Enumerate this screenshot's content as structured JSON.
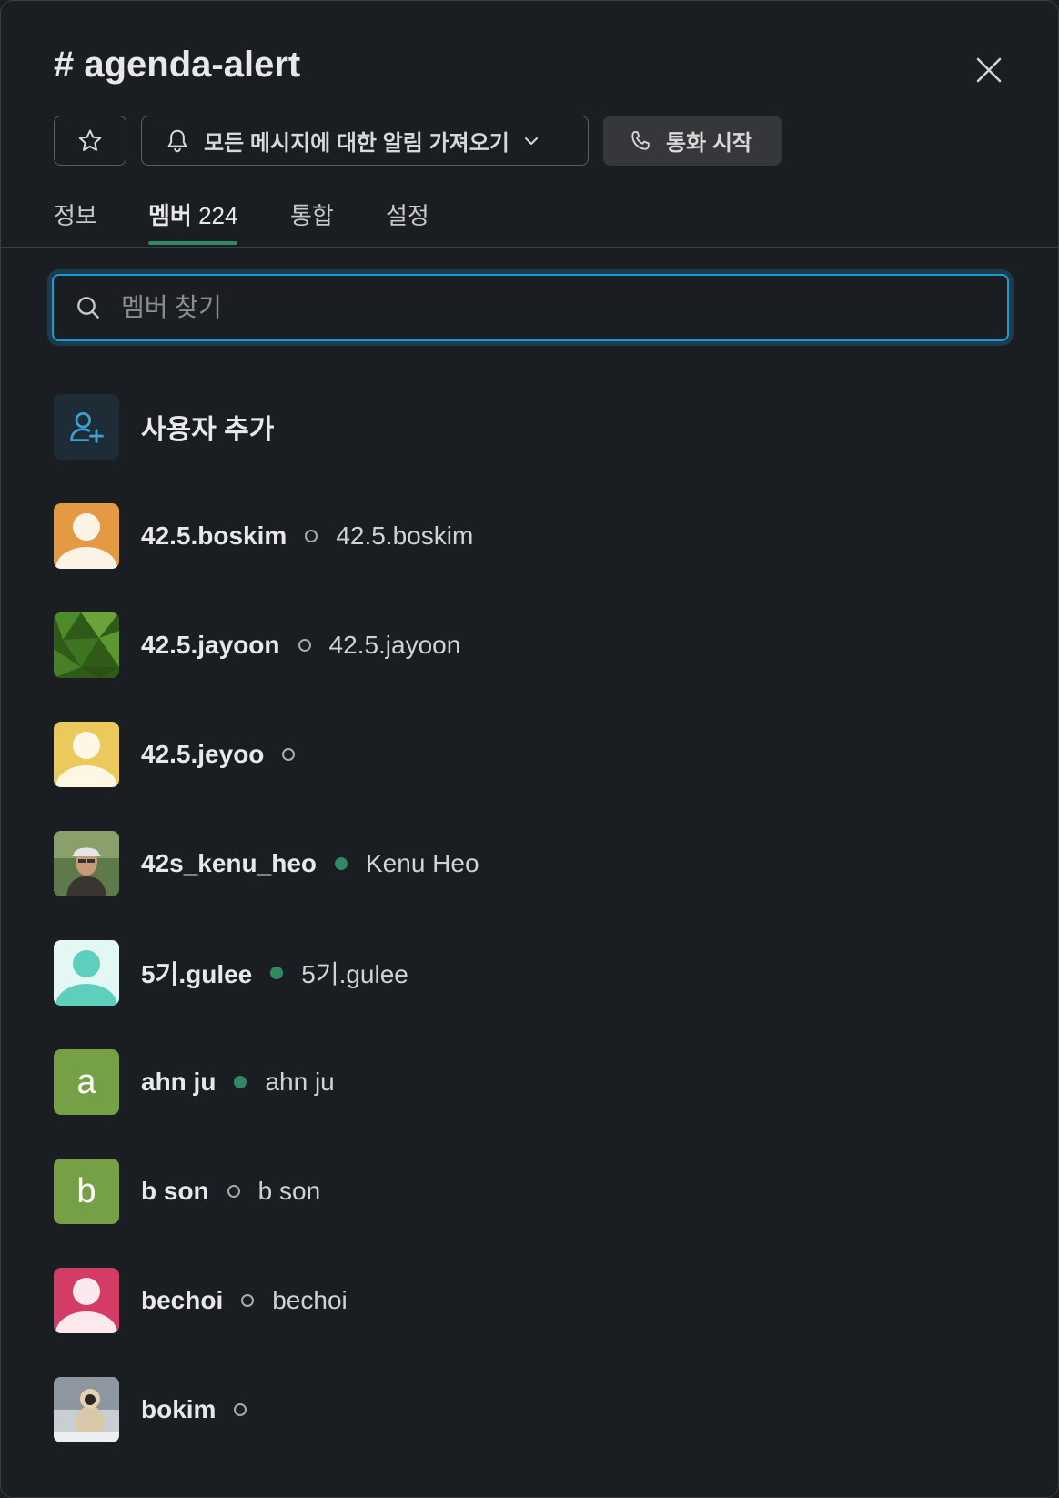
{
  "header": {
    "title": "# agenda-alert",
    "notify_label": "모든 메시지에 대한 알림 가져오기",
    "call_label": "통화 시작"
  },
  "tabs": [
    {
      "label": "정보"
    },
    {
      "label": "멤버",
      "count": "224"
    },
    {
      "label": "통합"
    },
    {
      "label": "설정"
    }
  ],
  "search": {
    "placeholder": "멤버 찾기"
  },
  "add_user": {
    "label": "사용자 추가"
  },
  "members": [
    {
      "name": "42.5.boskim",
      "status": "away",
      "real_name": "42.5.boskim",
      "avatar": "person",
      "color": "#e39a42",
      "fg": "#fdf2e6"
    },
    {
      "name": "42.5.jayoon",
      "status": "away",
      "real_name": "42.5.jayoon",
      "avatar": "leaf",
      "color": "#3f6b22"
    },
    {
      "name": "42.5.jeyoo",
      "status": "away",
      "real_name": "",
      "avatar": "person",
      "color": "#ecc95c",
      "fg": "#fdf7e4"
    },
    {
      "name": "42s_kenu_heo",
      "status": "active",
      "real_name": "Kenu Heo",
      "avatar": "photo-man",
      "color": "#4d6b3a"
    },
    {
      "name": "5기.gulee",
      "status": "active",
      "real_name": "5기.gulee",
      "avatar": "person",
      "color": "#e3f7f3",
      "fg": "#5fcfbd"
    },
    {
      "name": "ahn ju",
      "status": "active",
      "real_name": "ahn ju",
      "avatar": "letter",
      "letter": "a",
      "color": "#76a045"
    },
    {
      "name": "b son",
      "status": "away",
      "real_name": "b son",
      "avatar": "letter",
      "letter": "b",
      "color": "#76a045"
    },
    {
      "name": "bechoi",
      "status": "away",
      "real_name": "bechoi",
      "avatar": "person",
      "color": "#d33c64",
      "fg": "#fbe9ee"
    },
    {
      "name": "bokim",
      "status": "away",
      "real_name": "",
      "avatar": "photo-monkey",
      "color": "#9aa3ad"
    }
  ]
}
